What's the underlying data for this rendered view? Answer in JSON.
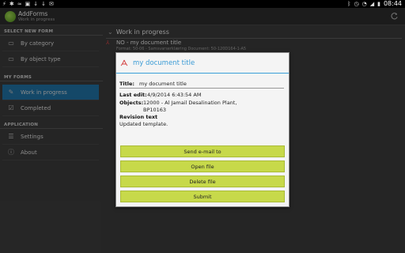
{
  "status_bar": {
    "left_icons": [
      "usb-icon",
      "bug-icon",
      "wifi-icon",
      "image-icon",
      "download-icon",
      "download-icon",
      "notification-icon"
    ],
    "right_icons": [
      "bluetooth-icon",
      "alarm-icon",
      "wifi-signal-icon",
      "cell-signal-icon",
      "battery-icon"
    ],
    "time": "08:44"
  },
  "action_bar": {
    "title": "AddForms",
    "subtitle": "Work in progress",
    "refresh_icon": "refresh-icon"
  },
  "sidebar": {
    "sections": [
      {
        "header": "SELECT NEW FORM",
        "items": [
          {
            "label": "By category",
            "icon": "folder-icon"
          },
          {
            "label": "By object type",
            "icon": "object-type-icon"
          }
        ]
      },
      {
        "header": "MY FORMS",
        "items": [
          {
            "label": "Work in progress",
            "icon": "document-edit-icon",
            "active": true
          },
          {
            "label": "Completed",
            "icon": "check-icon"
          }
        ]
      },
      {
        "header": "APPLICATION",
        "items": [
          {
            "label": "Settings",
            "icon": "sliders-icon"
          },
          {
            "label": "About",
            "icon": "info-icon"
          }
        ]
      }
    ]
  },
  "main": {
    "header": "Work in progress",
    "list": [
      {
        "title": "NO - my document title",
        "meta": "Format: 50-06 - Samsvarserklæring   Document: 50-120D164-1-A5"
      }
    ]
  },
  "dialog": {
    "title": "my document title",
    "fields": {
      "title_label": "Title:",
      "title_value": "my document title",
      "last_edit_label": "Last edit:",
      "last_edit_value": "4/9/2014 6:43:54 AM",
      "objects_label": "Objects:",
      "objects_value_line1": "12000 - Al Jamail Desalination Plant,",
      "objects_value_line2": "BP10163",
      "revision_label": "Revision text",
      "revision_value": "Updated template."
    },
    "buttons": [
      "Send e-mail to",
      "Open file",
      "Delete file",
      "Submit"
    ]
  },
  "colors": {
    "accent_blue": "#3a9bd5",
    "active_item": "#1f6fa0",
    "button_green": "#c7d94a",
    "pdf_red": "#d44444"
  }
}
